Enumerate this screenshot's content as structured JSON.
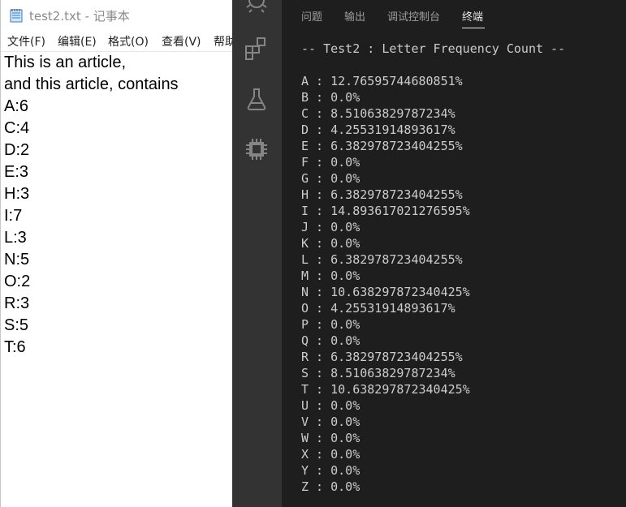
{
  "notepad": {
    "title": "test2.txt - 记事本",
    "menu": [
      "文件(F)",
      "编辑(E)",
      "格式(O)",
      "查看(V)",
      "帮助"
    ],
    "lines": [
      "This is an article,",
      "and this article, contains",
      "A:6",
      "C:4",
      "D:2",
      "E:3",
      "H:3",
      "I:7",
      "L:3",
      "N:5",
      "O:2",
      "R:3",
      "S:5",
      "T:6"
    ]
  },
  "vscode": {
    "activity_icons": [
      "debug-icon",
      "extensions-icon",
      "testing-flask-icon",
      "chip-icon"
    ],
    "panel_tabs": [
      "问题",
      "输出",
      "调试控制台",
      "终端"
    ],
    "active_tab": "终端",
    "terminal": {
      "header": "-- Test2 : Letter Frequency Count --",
      "lines": [
        "A : 12.76595744680851%",
        "B : 0.0%",
        "C : 8.51063829787234%",
        "D : 4.25531914893617%",
        "E : 6.382978723404255%",
        "F : 0.0%",
        "G : 0.0%",
        "H : 6.382978723404255%",
        "I : 14.893617021276595%",
        "J : 0.0%",
        "K : 0.0%",
        "L : 6.382978723404255%",
        "M : 0.0%",
        "N : 10.638297872340425%",
        "O : 4.25531914893617%",
        "P : 0.0%",
        "Q : 0.0%",
        "R : 6.382978723404255%",
        "S : 8.51063829787234%",
        "T : 10.638297872340425%",
        "U : 0.0%",
        "V : 0.0%",
        "W : 0.0%",
        "X : 0.0%",
        "Y : 0.0%",
        "Z : 0.0%"
      ]
    }
  },
  "colors": {
    "terminal_bg": "#1e1e1e",
    "activity_bar": "#333333",
    "terminal_text": "#cccccc",
    "active_tab": "#e7e7e7"
  }
}
